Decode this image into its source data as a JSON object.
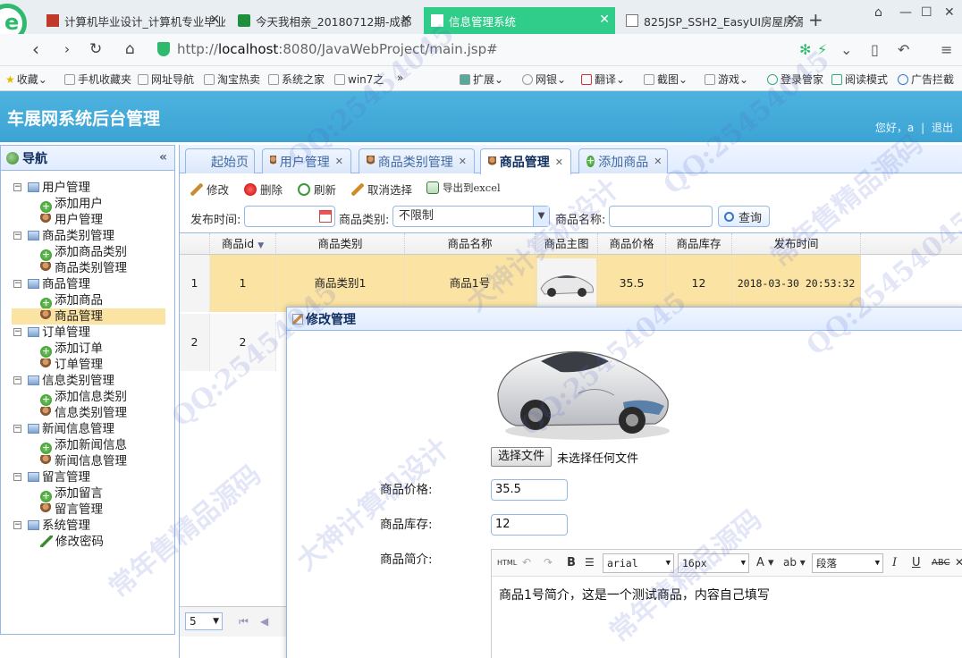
{
  "browser": {
    "tabs": [
      {
        "label": "计算机毕业设计_计算机专业毕业设计",
        "active": false
      },
      {
        "label": "今天我相亲_20180712期-成都",
        "active": false
      },
      {
        "label": "信息管理系统",
        "active": true
      },
      {
        "label": "825JSP_SSH2_EasyUI房屋房源",
        "active": false
      }
    ],
    "url_prefix": "http://",
    "url_host": "localhost",
    "url_rest": ":8080/JavaWebProject/main.jsp#",
    "bookmarks": [
      "收藏",
      "手机收藏夹",
      "网址导航",
      "淘宝热卖",
      "系统之家",
      "win7之",
      "扩展",
      "网银",
      "翻译",
      "截图",
      "游戏",
      "登录管家",
      "阅读模式",
      "广告拦截"
    ]
  },
  "header": {
    "title": "车展网系统后台管理",
    "greeting": "您好，a",
    "logout": "退出"
  },
  "sidenav": {
    "title": "导航",
    "groups": [
      {
        "label": "用户管理",
        "items": [
          {
            "label": "添加用户",
            "icon": "add"
          },
          {
            "label": "用户管理",
            "icon": "user"
          }
        ]
      },
      {
        "label": "商品类别管理",
        "items": [
          {
            "label": "添加商品类别",
            "icon": "add"
          },
          {
            "label": "商品类别管理",
            "icon": "user"
          }
        ]
      },
      {
        "label": "商品管理",
        "items": [
          {
            "label": "添加商品",
            "icon": "add"
          },
          {
            "label": "商品管理",
            "icon": "user",
            "selected": true
          }
        ]
      },
      {
        "label": "订单管理",
        "items": [
          {
            "label": "添加订单",
            "icon": "add"
          },
          {
            "label": "订单管理",
            "icon": "user"
          }
        ]
      },
      {
        "label": "信息类别管理",
        "items": [
          {
            "label": "添加信息类别",
            "icon": "add"
          },
          {
            "label": "信息类别管理",
            "icon": "user"
          }
        ]
      },
      {
        "label": "新闻信息管理",
        "items": [
          {
            "label": "添加新闻信息",
            "icon": "add"
          },
          {
            "label": "新闻信息管理",
            "icon": "user"
          }
        ]
      },
      {
        "label": "留言管理",
        "items": [
          {
            "label": "添加留言",
            "icon": "add"
          },
          {
            "label": "留言管理",
            "icon": "user"
          }
        ]
      },
      {
        "label": "系统管理",
        "items": [
          {
            "label": "修改密码",
            "icon": "pen"
          }
        ]
      }
    ]
  },
  "main": {
    "tabs": [
      "起始页",
      "用户管理",
      "商品类别管理",
      "商品管理",
      "添加商品"
    ],
    "toolbar": [
      "修改",
      "删除",
      "刷新",
      "取消选择",
      "导出到excel"
    ],
    "search": {
      "date_label": "发布时间:",
      "category_label": "商品类别:",
      "category_value": "不限制",
      "name_label": "商品名称:",
      "query_button": "查询"
    },
    "columns": [
      "商品id",
      "商品类别",
      "商品名称",
      "商品主图",
      "商品价格",
      "商品库存",
      "发布时间"
    ],
    "rows": [
      {
        "rownum": "1",
        "id": "1",
        "category": "商品类别1",
        "name": "商品1号",
        "price": "35.5",
        "stock": "12",
        "time": "2018-03-30 20:53:32"
      },
      {
        "rownum": "2",
        "id": "2"
      }
    ],
    "pager": {
      "page_size": "5"
    }
  },
  "dialog": {
    "title": "修改管理",
    "file_button": "选择文件",
    "file_status": "未选择任何文件",
    "price_label": "商品价格:",
    "price_value": "35.5",
    "stock_label": "商品库存:",
    "stock_value": "12",
    "intro_label": "商品简介:",
    "editor": {
      "font": "arial",
      "size": "16px",
      "format": "段落",
      "content": "商品1号简介，这是一个测试商品，内容自己填写"
    }
  },
  "watermark": {
    "lines": [
      "QQ:25454045",
      "大神计算机设计",
      "常年售精品源码"
    ]
  }
}
